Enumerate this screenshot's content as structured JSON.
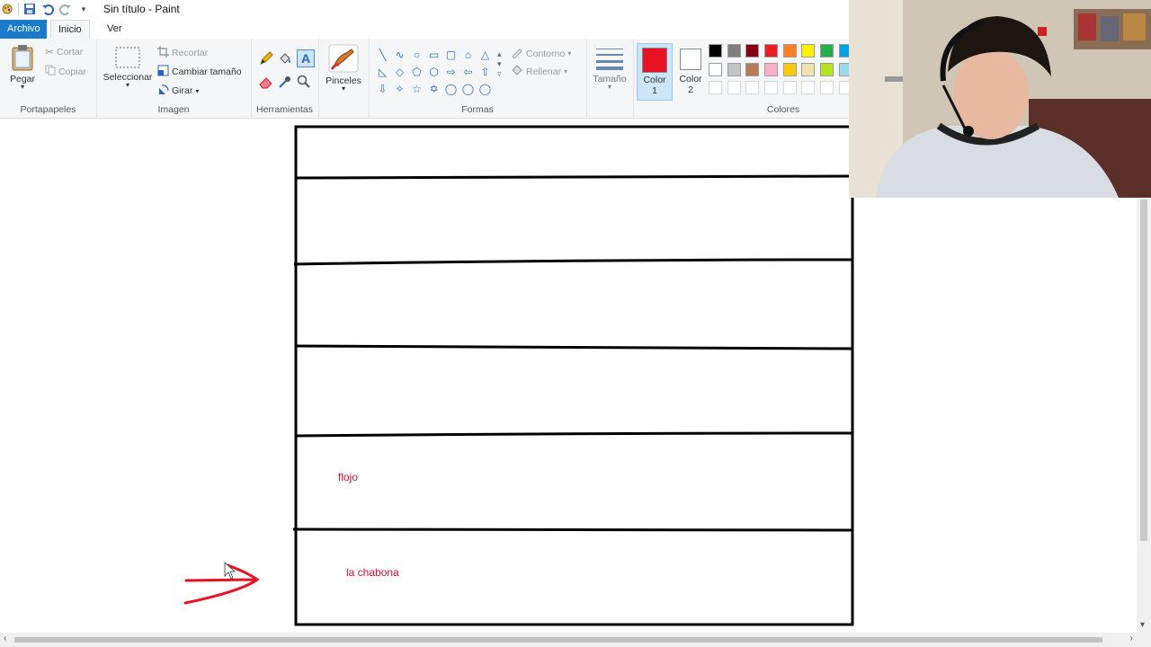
{
  "window": {
    "title": "Sin título - Paint"
  },
  "menu": {
    "file": "Archivo",
    "home": "Inicio",
    "view": "Ver"
  },
  "clipboard": {
    "paste": "Pegar",
    "cut": "Cortar",
    "copy": "Copiar",
    "label": "Portapapeles"
  },
  "image": {
    "select": "Seleccionar",
    "crop": "Recortar",
    "resize": "Cambiar tamaño",
    "rotate": "Girar",
    "label": "Imagen"
  },
  "tools": {
    "label": "Herramientas",
    "text_icon": "A"
  },
  "brushes": {
    "label": "Pinceles"
  },
  "shapes": {
    "outline": "Contorno",
    "fill": "Rellenar",
    "label": "Formas",
    "glyphs": [
      "╲",
      "∿",
      "○",
      "▭",
      "▢",
      "⌂",
      "△",
      "◺",
      "◇",
      "⬠",
      "⬡",
      "⇨",
      "⇦",
      "⇧",
      "⇩",
      "✧",
      "☆",
      "✡",
      "◯",
      "◯",
      "◯"
    ]
  },
  "size": {
    "label": "Tamaño"
  },
  "color1": {
    "label": "Color",
    "num": "1",
    "value": "#e81224"
  },
  "color2": {
    "label": "Color",
    "num": "2",
    "value": "#ffffff"
  },
  "colors": {
    "label": "Colores",
    "row1": [
      "#000000",
      "#7f7f7f",
      "#880015",
      "#ed1c24",
      "#ff7f27",
      "#fff200",
      "#22b14c",
      "#00a2e8"
    ],
    "row2": [
      "#ffffff",
      "#c3c3c3",
      "#b97a57",
      "#ffaec9",
      "#ffc90e",
      "#efe4b0",
      "#b5e61d",
      "#99d9ea"
    ]
  },
  "canvas": {
    "label_row5": "flojo",
    "label_row6": "la chabona",
    "ink_color": "#e81224"
  }
}
